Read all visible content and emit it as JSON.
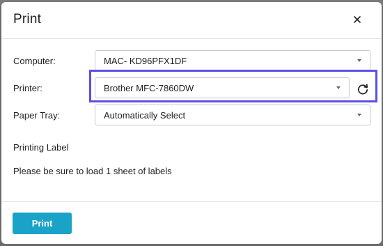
{
  "dialog": {
    "title": "Print",
    "close_icon": "close-icon"
  },
  "form": {
    "computer": {
      "label": "Computer:",
      "value": "MAC- KD96PFX1DF"
    },
    "printer": {
      "label": "Printer:",
      "value": "Brother MFC-7860DW",
      "refresh_icon": "refresh-icon"
    },
    "paper_tray": {
      "label": "Paper Tray:",
      "value": "Automatically Select"
    }
  },
  "info": {
    "printing_label": "Printing Label",
    "instruction": "Please be sure to load 1 sheet of labels"
  },
  "footer": {
    "print_label": "Print"
  },
  "colors": {
    "primary_button": "#1aa3c8",
    "highlight_outline": "#5a50e6"
  }
}
